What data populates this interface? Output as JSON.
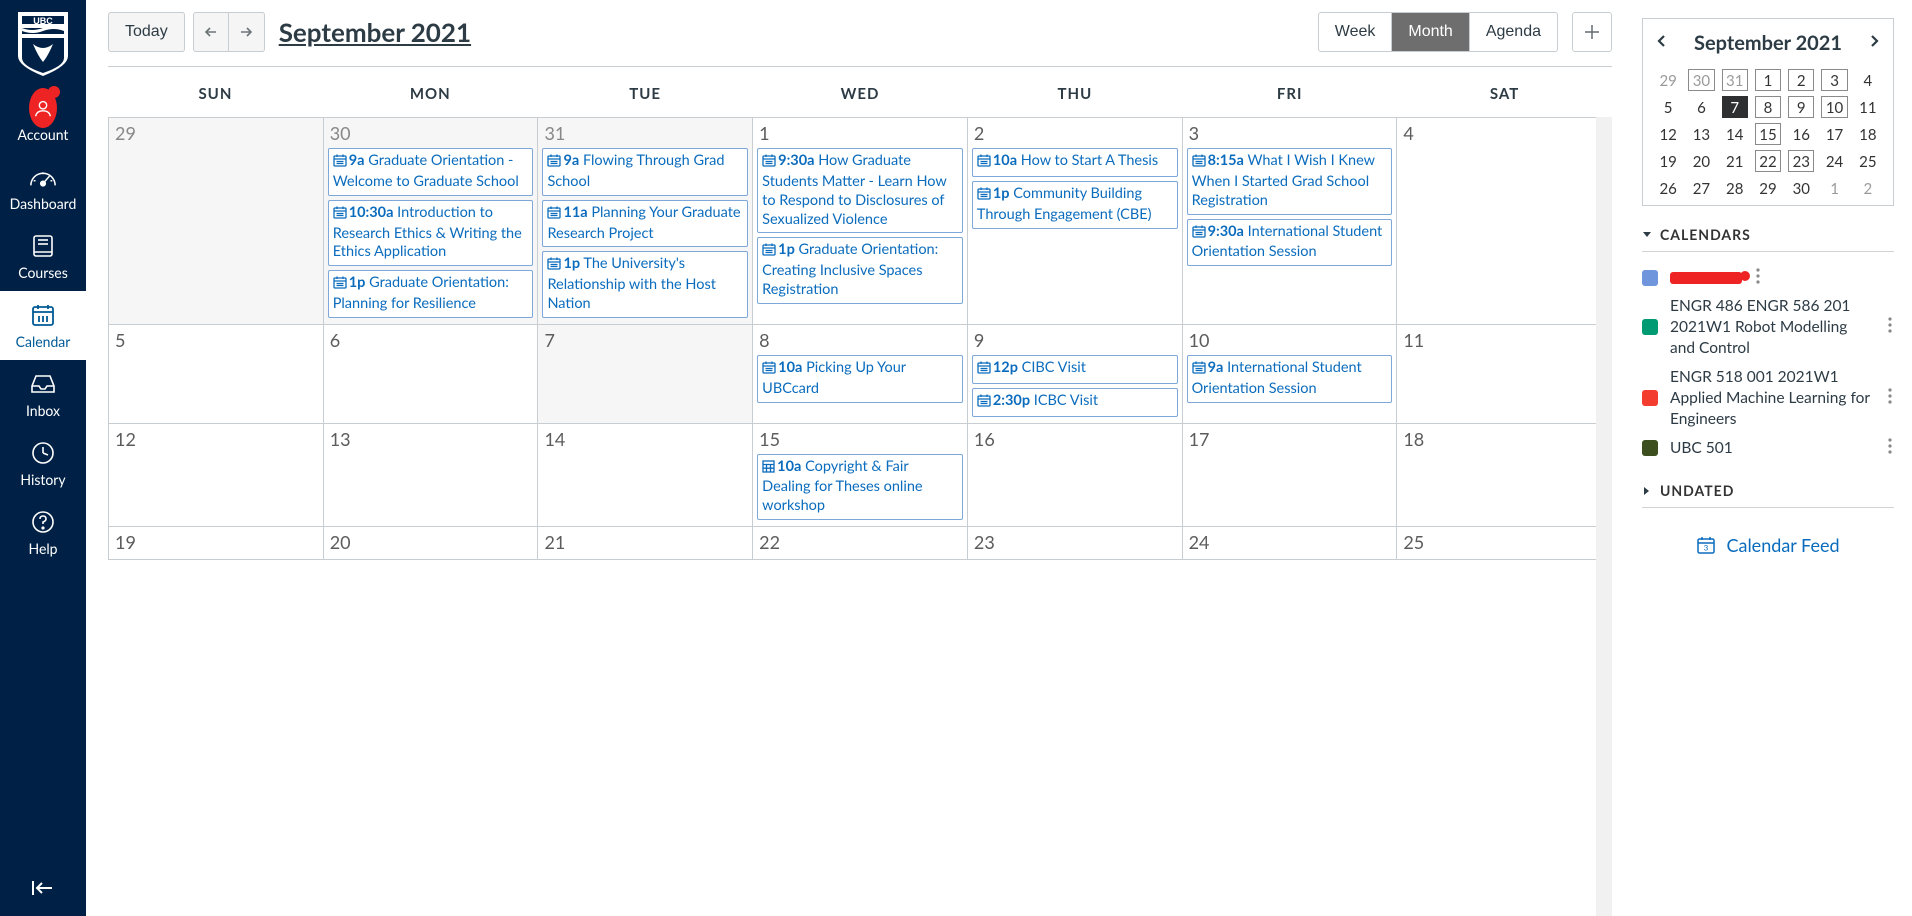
{
  "nav": {
    "items": [
      {
        "key": "account",
        "label": "Account"
      },
      {
        "key": "dashboard",
        "label": "Dashboard"
      },
      {
        "key": "courses",
        "label": "Courses"
      },
      {
        "key": "calendar",
        "label": "Calendar",
        "active": true
      },
      {
        "key": "inbox",
        "label": "Inbox"
      },
      {
        "key": "history",
        "label": "History"
      },
      {
        "key": "help",
        "label": "Help"
      }
    ]
  },
  "header": {
    "today_label": "Today",
    "title": "September 2021",
    "views": {
      "week": "Week",
      "month": "Month",
      "agenda": "Agenda"
    },
    "active_view": "month"
  },
  "dow": [
    "SUN",
    "MON",
    "TUE",
    "WED",
    "THU",
    "FRI",
    "SAT"
  ],
  "weeks": [
    [
      {
        "date": "29",
        "dim": true,
        "events": []
      },
      {
        "date": "30",
        "dim": true,
        "events": [
          {
            "icon": "sched",
            "time": "9a",
            "title": "Graduate Orientation - Welcome to Graduate School"
          },
          {
            "icon": "sched",
            "time": "10:30a",
            "title": "Introduction to Research Ethics & Writing the Ethics Application"
          },
          {
            "icon": "sched",
            "time": "1p",
            "title": "Graduate Orientation: Planning for Resilience"
          }
        ]
      },
      {
        "date": "31",
        "dim": true,
        "events": [
          {
            "icon": "sched",
            "time": "9a",
            "title": "Flowing Through Grad School"
          },
          {
            "icon": "sched",
            "time": "11a",
            "title": "Planning Your Graduate Research Project"
          },
          {
            "icon": "sched",
            "time": "1p",
            "title": "The University's Relationship with the Host Nation"
          }
        ]
      },
      {
        "date": "1",
        "events": [
          {
            "icon": "sched",
            "time": "9:30a",
            "title": "How Graduate Students Matter - Learn How to Respond to Disclosures of Sexualized Violence"
          },
          {
            "icon": "sched",
            "time": "1p",
            "title": "Graduate Orientation: Creating Inclusive Spaces Registration"
          }
        ]
      },
      {
        "date": "2",
        "events": [
          {
            "icon": "sched",
            "time": "10a",
            "title": "How to Start A Thesis"
          },
          {
            "icon": "sched",
            "time": "1p",
            "title": "Community Building Through Engagement (CBE)"
          }
        ]
      },
      {
        "date": "3",
        "events": [
          {
            "icon": "sched",
            "time": "8:15a",
            "title": "What I Wish I Knew When I Started Grad School Registration"
          },
          {
            "icon": "sched",
            "time": "9:30a",
            "title": "International Student Orientation Session"
          }
        ]
      },
      {
        "date": "4",
        "events": []
      }
    ],
    [
      {
        "date": "5",
        "events": []
      },
      {
        "date": "6",
        "events": []
      },
      {
        "date": "7",
        "today": true,
        "events": []
      },
      {
        "date": "8",
        "events": [
          {
            "icon": "sched",
            "time": "10a",
            "title": "Picking Up Your UBCcard"
          }
        ]
      },
      {
        "date": "9",
        "events": [
          {
            "icon": "sched",
            "time": "12p",
            "title": "CIBC Visit"
          },
          {
            "icon": "sched",
            "time": "2:30p",
            "title": "ICBC Visit"
          }
        ]
      },
      {
        "date": "10",
        "events": [
          {
            "icon": "sched",
            "time": "9a",
            "title": "International Student Orientation Session"
          }
        ]
      },
      {
        "date": "11",
        "events": []
      }
    ],
    [
      {
        "date": "12",
        "events": []
      },
      {
        "date": "13",
        "events": []
      },
      {
        "date": "14",
        "events": []
      },
      {
        "date": "15",
        "events": [
          {
            "icon": "box",
            "time": "10a",
            "title": "Copyright & Fair Dealing for Theses online workshop"
          }
        ]
      },
      {
        "date": "16",
        "events": []
      },
      {
        "date": "17",
        "events": []
      },
      {
        "date": "18",
        "events": []
      }
    ],
    [
      {
        "date": "19",
        "events": []
      },
      {
        "date": "20",
        "events": []
      },
      {
        "date": "21",
        "events": []
      },
      {
        "date": "22",
        "events": []
      },
      {
        "date": "23",
        "events": []
      },
      {
        "date": "24",
        "events": []
      },
      {
        "date": "25",
        "events": []
      }
    ]
  ],
  "mini": {
    "title": "September 2021",
    "days": [
      {
        "n": "29",
        "outside": true
      },
      {
        "n": "30",
        "outside": true,
        "ev": true
      },
      {
        "n": "31",
        "outside": true,
        "ev": true
      },
      {
        "n": "1",
        "ev": true
      },
      {
        "n": "2",
        "ev": true
      },
      {
        "n": "3",
        "ev": true
      },
      {
        "n": "4"
      },
      {
        "n": "5"
      },
      {
        "n": "6"
      },
      {
        "n": "7",
        "today": true
      },
      {
        "n": "8",
        "ev": true
      },
      {
        "n": "9",
        "ev": true
      },
      {
        "n": "10",
        "ev": true
      },
      {
        "n": "11"
      },
      {
        "n": "12"
      },
      {
        "n": "13"
      },
      {
        "n": "14"
      },
      {
        "n": "15",
        "ev": true
      },
      {
        "n": "16"
      },
      {
        "n": "17"
      },
      {
        "n": "18"
      },
      {
        "n": "19"
      },
      {
        "n": "20"
      },
      {
        "n": "21"
      },
      {
        "n": "22",
        "ev": true
      },
      {
        "n": "23",
        "ev": true
      },
      {
        "n": "24"
      },
      {
        "n": "25"
      },
      {
        "n": "26"
      },
      {
        "n": "27"
      },
      {
        "n": "28"
      },
      {
        "n": "29"
      },
      {
        "n": "30"
      },
      {
        "n": "1",
        "outside": true
      },
      {
        "n": "2",
        "outside": true
      }
    ]
  },
  "sidebar": {
    "calendars_heading": "CALENDARS",
    "undated_heading": "UNDATED",
    "feed_label": "Calendar Feed",
    "calendars": [
      {
        "color": "#6f95dc",
        "redacted": true
      },
      {
        "color": "#009b72",
        "title": "ENGR 486 ENGR 586 201 2021W1 Robot Modelling and Control"
      },
      {
        "color": "#f23d2f",
        "title": "ENGR 518 001 2021W1 Applied Machine Learning for Engineers"
      },
      {
        "color": "#3d4f1e",
        "title": "UBC 501"
      }
    ]
  }
}
